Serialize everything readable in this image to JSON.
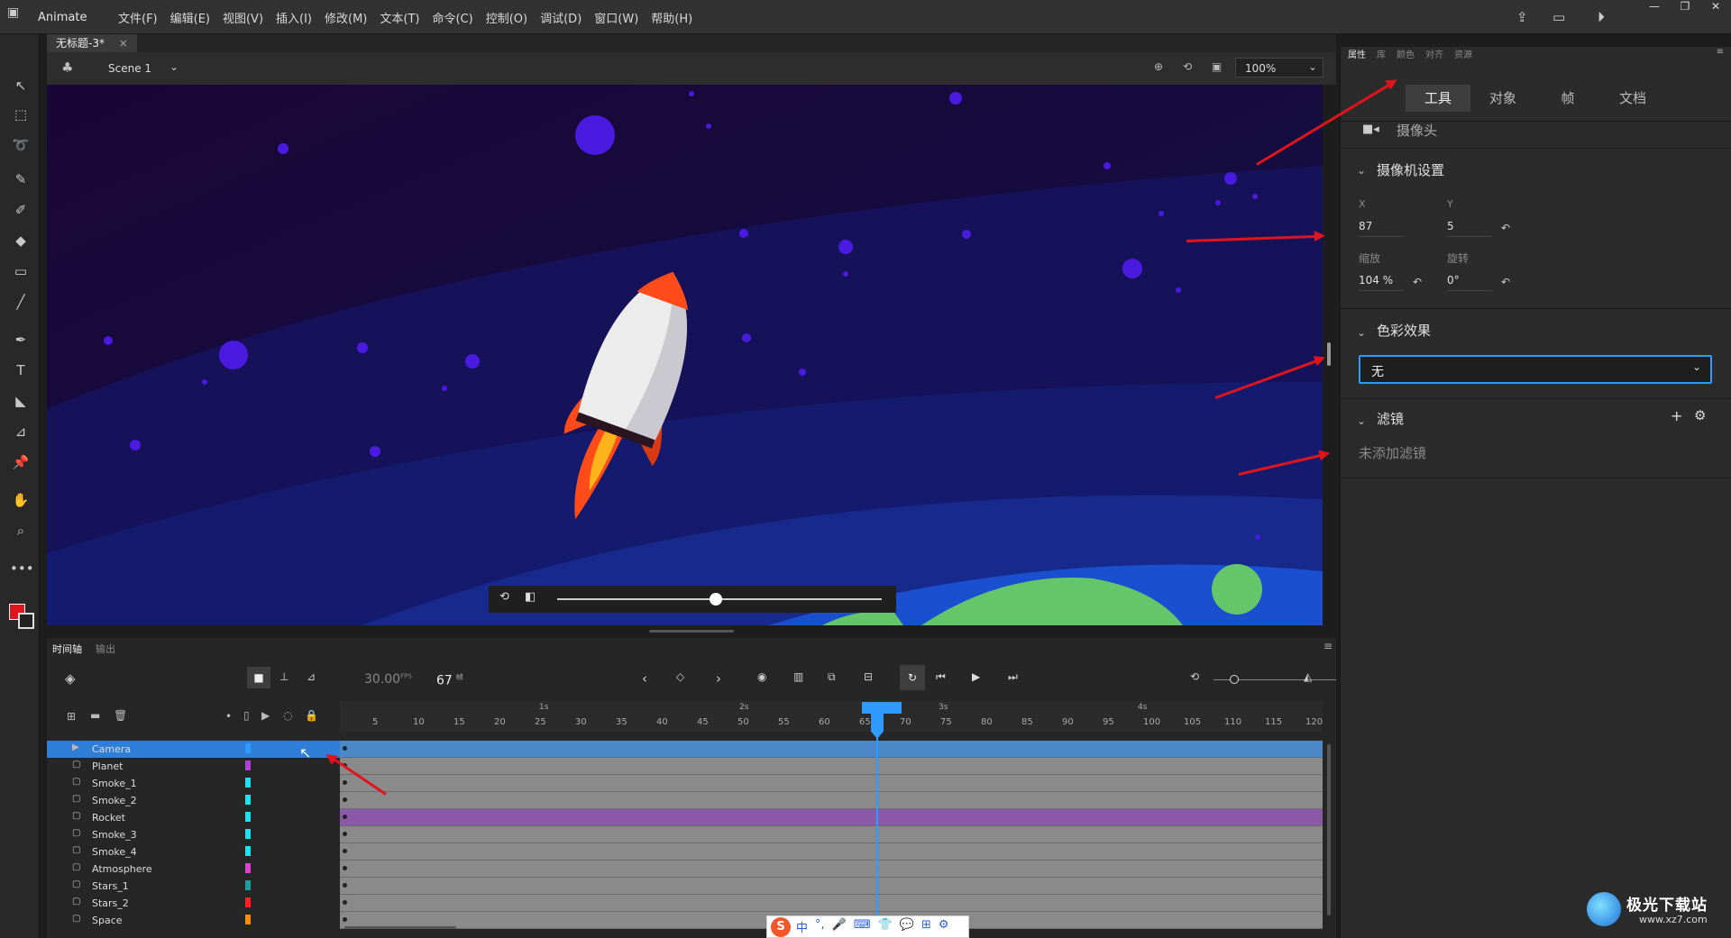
{
  "menubar": {
    "app": "Animate",
    "items": [
      "文件(F)",
      "编辑(E)",
      "视图(V)",
      "插入(I)",
      "修改(M)",
      "文本(T)",
      "命令(C)",
      "控制(O)",
      "调试(D)",
      "窗口(W)",
      "帮助(H)"
    ]
  },
  "document": {
    "tab": "无标题-3*",
    "close": "×"
  },
  "scene": {
    "name": "Scene 1",
    "zoom": "100%"
  },
  "timeline": {
    "tabs": [
      "时间轴",
      "输出"
    ],
    "fps": "30.00",
    "fps_unit": "FPS",
    "frame": "67",
    "frame_unit": "帧",
    "seconds": [
      "1s",
      "2s",
      "3s",
      "4s"
    ],
    "ticks": [
      "5",
      "10",
      "15",
      "20",
      "25",
      "30",
      "35",
      "40",
      "45",
      "50",
      "55",
      "60",
      "65",
      "70",
      "75",
      "80",
      "85",
      "90",
      "95",
      "100",
      "105",
      "110",
      "115",
      "120"
    ],
    "layers": [
      {
        "name": "Camera",
        "color": "#2f9bff",
        "selected": true
      },
      {
        "name": "Planet",
        "color": "#b13fd8"
      },
      {
        "name": "Smoke_1",
        "color": "#1ee0f0"
      },
      {
        "name": "Smoke_2",
        "color": "#1ee0f0"
      },
      {
        "name": "Rocket",
        "color": "#1ee0f0"
      },
      {
        "name": "Smoke_3",
        "color": "#1ee0f0"
      },
      {
        "name": "Smoke_4",
        "color": "#1ee0f0"
      },
      {
        "name": "Atmosphere",
        "color": "#e040d0"
      },
      {
        "name": "Stars_1",
        "color": "#16a0a0"
      },
      {
        "name": "Stars_2",
        "color": "#ff2020"
      },
      {
        "name": "Space",
        "color": "#ff8c00"
      }
    ]
  },
  "properties": {
    "top_tabs": [
      "属性",
      "库",
      "颜色",
      "对齐",
      "资源"
    ],
    "tabs": [
      "工具",
      "对象",
      "帧",
      "文档"
    ],
    "camera_label": "摄像头",
    "camera_settings": "摄像机设置",
    "x_label": "X",
    "x_value": "87",
    "y_label": "Y",
    "y_value": "5",
    "scale_label": "缩放",
    "scale_value": "104 %",
    "rotate_label": "旋转",
    "rotate_value": "0°",
    "color_effect": "色彩效果",
    "color_effect_value": "无",
    "filters": "滤镜",
    "no_filters": "未添加滤镜"
  },
  "ime": {
    "items": [
      "中",
      "°,",
      "🎤",
      "⌨",
      "👕",
      "💬",
      "⊞",
      "⚙"
    ]
  },
  "watermark": {
    "text": "极光下载站",
    "url": "www.xz7.com"
  },
  "colors": {
    "accent": "#2f9bff",
    "arrow": "#e0141c"
  }
}
